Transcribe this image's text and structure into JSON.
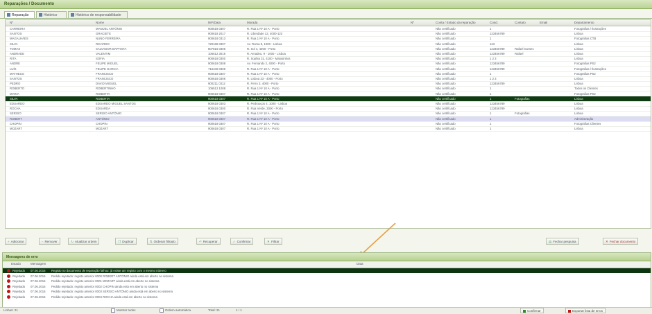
{
  "window": {
    "title": "Reparações / Documento"
  },
  "tabs": [
    {
      "label": "Reparação"
    },
    {
      "label": "Histórico"
    },
    {
      "label": "Histórico de responsabilidade"
    }
  ],
  "grid": {
    "columns": [
      "Nº",
      "Nome",
      "NIF/Data",
      "Morada",
      "Nº",
      "Conta / Estado da reparação",
      "Cond.",
      "Contato",
      "Email",
      "Departamento"
    ],
    "rows": [
      [
        "CARREIRA",
        "MANUEL ANTÓNIO",
        "900618 0307",
        "R. Rua 1 Nº 10 A - Porto",
        "",
        "Não certificado",
        "1",
        "",
        "",
        "Fotografias / Ilustrações"
      ],
      [
        "SANTOS",
        "GRACIETE",
        "900618 2017",
        "R. Liberdade 12, 4000-123",
        "",
        "Não certificado",
        "123456789",
        "",
        "",
        "Lisboa"
      ],
      [
        "MAGALHÃES",
        "NUNO FERREIRA",
        "900618 0313",
        "R. Rua 1 Nº 10 A - Porto",
        "",
        "Não certificado",
        "1",
        "",
        "",
        "Fotografias CTB"
      ],
      [
        "SILVA",
        "RICARDO",
        "720186 0307",
        "Av. Roma 8, 1000 - Lisboa",
        "",
        "Não certificado",
        "123",
        "",
        "",
        "Lisboa"
      ],
      [
        "TOMAS",
        "SALVADOR BAPTISTA",
        "807816 0306",
        "R. Sol 4, 4000 - Porto",
        "",
        "Não certificado",
        "123456789",
        "Rafael Gomes",
        "",
        "Lisboa"
      ],
      [
        "ANDRADE",
        "VALENTIM",
        "106512 3016",
        "R. Amadeu, 9 - 1000 - Lisboa",
        "",
        "Não certificado",
        "123456789",
        "Rafael",
        "",
        "Lisboa"
      ],
      [
        "RITA",
        "SOFIA",
        "900618 0300",
        "R. Sophia 31, 4100 - Matosinhos",
        "",
        "Não certificado",
        "1 2 3",
        "",
        "",
        "Lisboa"
      ],
      [
        "ANDRE",
        "FELIPE MIGUEL",
        "900618 0308",
        "Av. Fernando 2, 4000 - Porto",
        "",
        "Não certificado",
        "123456789",
        "",
        "",
        "Fotografias PS2"
      ],
      [
        "LUÍS",
        "FELIPE GARCIA",
        "716106 0306",
        "R. Rua 1 Nº 10 A - Porto",
        "",
        "Não certificado",
        "123456789",
        "",
        "",
        "Fotografias / Ilustrações"
      ],
      [
        "MATHEUS",
        "FRANCISCO",
        "900618 0307",
        "R. Rua 1 Nº 10 A - Porto",
        "",
        "Não certificado",
        "1",
        "",
        "",
        "Fotografias PS2"
      ],
      [
        "SANTOS",
        "FRANCISCO",
        "900618 0306",
        "R. Lisboa 33 - 4000 - Porto",
        "",
        "Não certificado",
        "1 2 3",
        "",
        "",
        "Lisboa"
      ],
      [
        "PEDRO",
        "DAVID MIGUEL",
        "900211 0312",
        "R. Ferro 3, 4000 - Porto",
        "",
        "Não certificado",
        "123456789",
        "",
        "",
        "Lisboa"
      ],
      [
        "ROBERTO",
        "ROBERTINHO",
        "106512 1008",
        "R. Rua 1 Nº 10 A - Porto",
        "",
        "Não certificado",
        "1",
        "",
        "",
        "Todos os Clientes"
      ],
      [
        "MARIA",
        "ROBERTA",
        "900618 0307",
        "R. Rua 1 Nº 10 A - Porto",
        "",
        "Não certificado",
        "1",
        "",
        "",
        "Fotografias PS2"
      ],
      [
        "SILVA",
        "ROBERTA",
        "900618 0307",
        "R. Rua 1 Nº 10 A - Porto",
        "",
        "Não certificado",
        "1",
        "Fotografias",
        "",
        "Lisboa"
      ],
      [
        "EDUARDO",
        "EDUARDO MIGUEL SANTOS",
        "900618 0303",
        "R. Pedrouços 4, 1000 - Lisboa",
        "",
        "Não certificado",
        "123456789",
        "",
        "",
        "Lisboa"
      ],
      [
        "ROCHA",
        "EDUARDA",
        "900618 0300",
        "R. Rua Verde, 3000 - Porto",
        "",
        "Não certificado",
        "123456789",
        "",
        "",
        "Lisboa"
      ],
      [
        "SERGIO",
        "SERGIO ANTÓNIO",
        "900618 0307",
        "R. Rua 1 Nº 10 A - Porto",
        "",
        "Não certificado",
        "1",
        "Fotografias",
        "",
        "Lisboa"
      ],
      [
        "ROBERT",
        "ANTÓNIO",
        "900618 0307",
        "R. Rua 1 Nº 10 A - Porto",
        "",
        "Não certificado",
        "1",
        "",
        "",
        "Administração"
      ],
      [
        "CHOPIN",
        "CHOPIN",
        "900618 0307",
        "R. Rua 1 Nº 10 A - Porto",
        "",
        "Não certificado",
        "1",
        "",
        "",
        "Fotografias Clientes"
      ],
      [
        "MOZART",
        "MOZART",
        "900618 0307",
        "R. Rua 1 Nº 10 A - Porto",
        "",
        "Não certificado",
        "1",
        "",
        "",
        "Lisboa"
      ]
    ],
    "selected_index": 14,
    "highlighted_index": 18
  },
  "toolbar": {
    "buttons": [
      {
        "label": "Adicionar",
        "icon": "plus-icon"
      },
      {
        "label": "Remover",
        "icon": "minus-icon"
      },
      {
        "label": "Atualizar ordem",
        "icon": "refresh-icon"
      },
      {
        "label": "Duplicar",
        "icon": "copy-icon"
      },
      {
        "label": "Ordenar filtrado",
        "icon": "sort-icon"
      },
      {
        "label": "Recuperar",
        "icon": "undo-icon"
      },
      {
        "label": "Confirmar",
        "icon": "check-icon"
      },
      {
        "label": "Filtrar",
        "icon": "filter-icon"
      }
    ],
    "right_buttons": [
      {
        "label": "Fechar pesquisa",
        "icon": "document-icon"
      },
      {
        "label": "Fechar documento",
        "icon": "close-icon",
        "danger": true
      }
    ]
  },
  "messages": {
    "title": "Mensagens de erro",
    "columns": [
      "Estado",
      "Mensagem",
      "Data"
    ],
    "rows": [
      [
        "Rejeitado",
        "07.06.2016",
        "Registo no documento de reparação falhou: já existe um registo com o mesmo número"
      ],
      [
        "Rejeitado",
        "07.06.2016",
        "Pedido rejeitado: registo anterior 0000 ROBERT ANTÓNIO ainda está em aberto no sistema"
      ],
      [
        "Rejeitado",
        "07.06.2016",
        "Pedido rejeitado: registo anterior 0001 MOZART ainda está em aberto no sistema"
      ],
      [
        "Rejeitado",
        "07.06.2016",
        "Pedido rejeitado: registo anterior 0002 CHOPIN ainda está em aberto no sistema"
      ],
      [
        "Rejeitado",
        "07.06.2016",
        "Pedido rejeitado: registo anterior 0003 SERGIO ANTÓNIO ainda está em aberto no sistema"
      ],
      [
        "Rejeitado",
        "07.06.2016",
        "Pedido rejeitado: registo anterior 0004 ROCHA ainda está em aberto no sistema"
      ]
    ],
    "selected_index": 0
  },
  "status_bar": {
    "left_text": "Linhas: 21",
    "checkbox1": "Mostrar todos",
    "checkbox2": "Ordem automática",
    "count": "Total: 21",
    "page": "1 / 1",
    "btn_ok": "Confirmar",
    "btn_export": "Exportar lista de erros",
    "accent": "#0f3a12",
    "error_color": "#c31414",
    "arrow_color": "#e8a040"
  }
}
